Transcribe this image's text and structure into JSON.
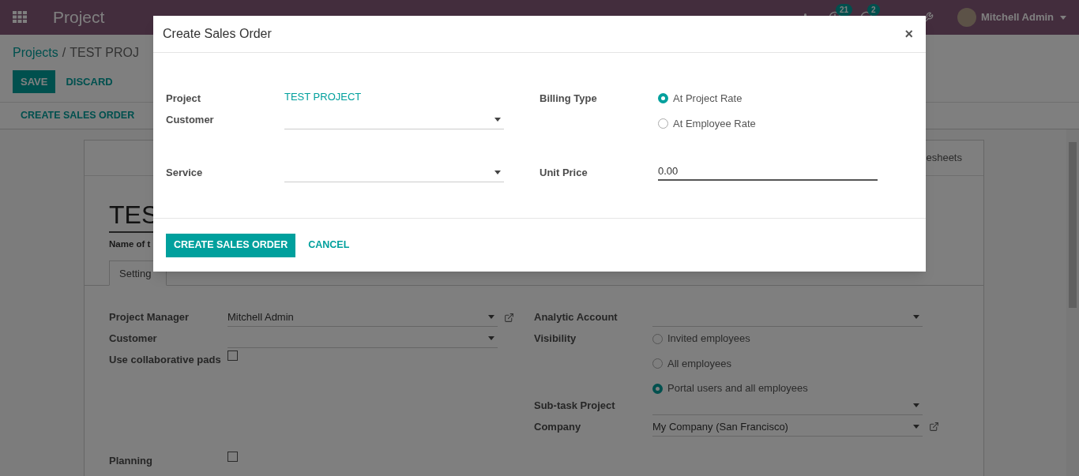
{
  "navbar": {
    "brand": "Project",
    "activity_count": "21",
    "message_count": "2",
    "user": "Mitchell Admin"
  },
  "breadcrumb": {
    "parent": "Projects",
    "separator": "/",
    "current": "TEST PROJ"
  },
  "actions": [
    {
      "label": "SAVE",
      "kind": "primary"
    },
    {
      "label": "DISCARD",
      "kind": "link"
    }
  ],
  "header_buttons": [
    "CREATE SALES ORDER"
  ],
  "form": {
    "stat_button": "esheets",
    "title": "TES",
    "name_label": "Name of t",
    "tabs": [
      {
        "label": "Setting",
        "selected": true
      }
    ],
    "left_fields": [
      {
        "label": "Project Manager",
        "kind": "select",
        "value": "Mitchell Admin",
        "external_link": true
      },
      {
        "label": "Customer",
        "kind": "select",
        "external_link": false
      },
      {
        "label": "Use collaborative pads",
        "kind": "checkbox",
        "checked": false
      }
    ],
    "right_fields": [
      {
        "label": "Analytic Account",
        "kind": "select",
        "external_link": false
      },
      {
        "label": "Visibility",
        "kind": "radio",
        "options": [
          {
            "label": "Invited employees",
            "selected": false
          },
          {
            "label": "All employees",
            "selected": false
          },
          {
            "label": "Portal users and all employees",
            "selected": true
          }
        ]
      },
      {
        "label": "Sub-task Project",
        "kind": "select",
        "external_link": false
      },
      {
        "label": "Company",
        "kind": "select",
        "value": "My Company (San Francisco)",
        "external_link": true
      }
    ],
    "lower_fields": [
      {
        "label": "Planning",
        "kind": "checkbox",
        "checked": false
      }
    ]
  },
  "dialog": {
    "title": "Create Sales Order",
    "close": "×",
    "rows": [
      {
        "left": [
          {
            "label": "Project",
            "kind": "link",
            "value": "TEST PROJECT"
          },
          {
            "label": "Customer",
            "kind": "select"
          }
        ],
        "right": [
          {
            "label": "Billing Type",
            "kind": "radio",
            "options": [
              {
                "label": "At Project Rate",
                "selected": true
              },
              {
                "label": "At Employee Rate",
                "selected": false
              }
            ]
          }
        ]
      },
      {
        "left": [
          {
            "label": "Service",
            "kind": "select"
          }
        ],
        "right": [
          {
            "label": "Unit Price",
            "kind": "input",
            "value": "0.00"
          }
        ]
      }
    ],
    "buttons": [
      {
        "label": "CREATE SALES ORDER",
        "kind": "primary"
      },
      {
        "label": "CANCEL",
        "kind": "link"
      }
    ]
  }
}
